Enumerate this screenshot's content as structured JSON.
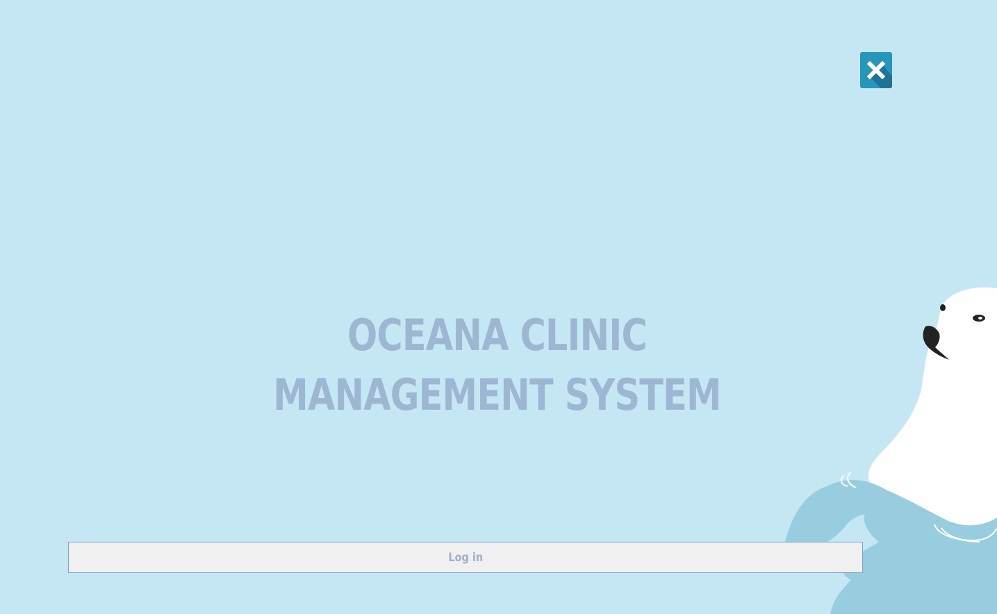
{
  "window": {
    "close_icon": "close-icon"
  },
  "title": {
    "line1": "OCEANA CLINIC",
    "line2": "MANAGEMENT SYSTEM"
  },
  "login": {
    "label": "Log in"
  },
  "decoration": {
    "mascot": "polar-bear-illustration"
  },
  "colors": {
    "background": "#c5e7f4",
    "close_button": "#2696ba",
    "title_text": "#9db6d2",
    "water": "#98cde0",
    "bear": "#ffffff",
    "login_border": "#7b9fd0",
    "login_text": "#9bb0cc"
  }
}
